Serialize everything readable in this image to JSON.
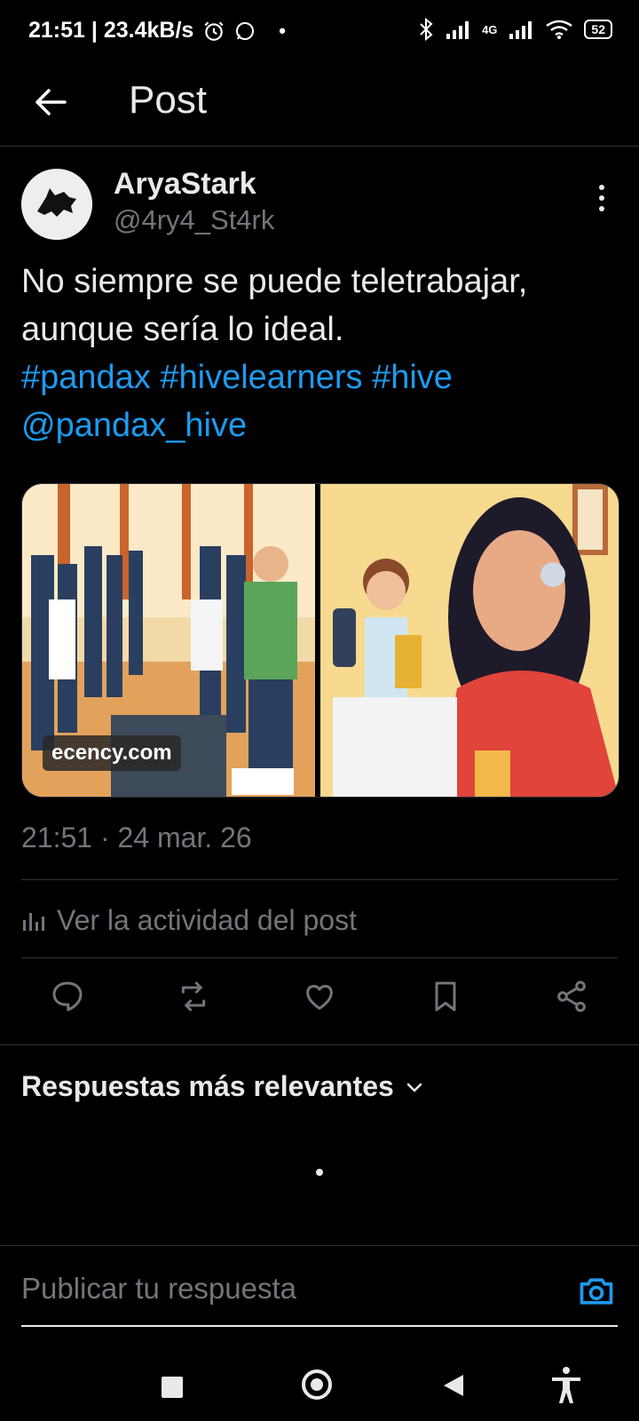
{
  "status_bar": {
    "time_speed": "21:51 | 23.4kB/s",
    "network": "4G",
    "battery": "52"
  },
  "header": {
    "title": "Post"
  },
  "post": {
    "author_name": "AryaStark",
    "author_handle": "@4ry4_St4rk",
    "text_line1": "No siempre se puede teletrabajar,",
    "text_line2": "aunque sería lo ideal.",
    "hashtags": [
      "#pandax",
      "#hivelearners",
      "#hive"
    ],
    "mention": "@pandax_hive",
    "watermark": "ecency.com",
    "timestamp": "21:51 · 24 mar. 26",
    "activity_label": "Ver la actividad del post"
  },
  "replies": {
    "sort_label": "Respuestas más relevantes",
    "input_placeholder": "Publicar tu respuesta"
  },
  "colors": {
    "accent": "#1d9bf0",
    "muted": "#71767b",
    "text": "#e7e9ea",
    "background": "#000000"
  },
  "icons": [
    "back-arrow-icon",
    "more-vertical-icon",
    "reply-icon",
    "repost-icon",
    "like-icon",
    "bookmark-icon",
    "share-icon",
    "camera-icon",
    "chevron-down-icon",
    "analytics-icon"
  ]
}
